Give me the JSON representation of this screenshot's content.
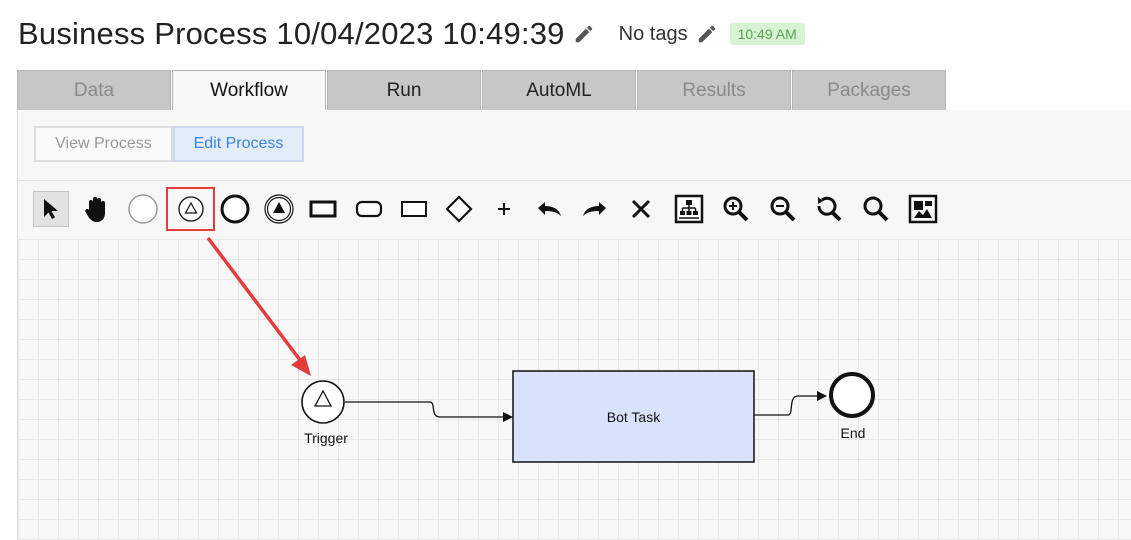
{
  "header": {
    "title": "Business Process 10/04/2023 10:49:39",
    "tags_label": "No tags",
    "time_badge": "10:49 AM"
  },
  "tabs": [
    {
      "label": "Data",
      "state": "disabled"
    },
    {
      "label": "Workflow",
      "state": "active"
    },
    {
      "label": "Run",
      "state": "enabled"
    },
    {
      "label": "AutoML",
      "state": "enabled"
    },
    {
      "label": "Results",
      "state": "disabled"
    },
    {
      "label": "Packages",
      "state": "disabled"
    }
  ],
  "mode": {
    "view_label": "View Process",
    "edit_label": "Edit Process",
    "active": "edit"
  },
  "toolbar": {
    "tools": [
      "pointer-icon",
      "hand-icon",
      "start-event-icon",
      "triggered-start-event-icon",
      "end-event-icon",
      "end-signal-event-icon",
      "task-icon",
      "subprocess-icon",
      "rectangle-icon",
      "gateway-icon",
      "add-icon",
      "undo-icon",
      "redo-icon",
      "delete-icon",
      "auto-layout-icon",
      "zoom-in-icon",
      "zoom-out-icon",
      "zoom-reset-icon",
      "zoom-fit-icon",
      "image-export-icon"
    ],
    "selected": "pointer-icon",
    "highlighted": "triggered-start-event-icon"
  },
  "diagram": {
    "nodes": [
      {
        "id": "trigger",
        "type": "start-triggered",
        "label": "Trigger"
      },
      {
        "id": "bot_task",
        "type": "task",
        "label": "Bot Task"
      },
      {
        "id": "end",
        "type": "end",
        "label": "End"
      }
    ],
    "edges": [
      {
        "from": "trigger",
        "to": "bot_task"
      },
      {
        "from": "bot_task",
        "to": "end"
      }
    ]
  },
  "colors": {
    "task_fill": "#d8e3fb",
    "annotation": "#e43b3b",
    "active_mode": "#3a86e6",
    "time_badge_bg": "#d8f3d4"
  }
}
